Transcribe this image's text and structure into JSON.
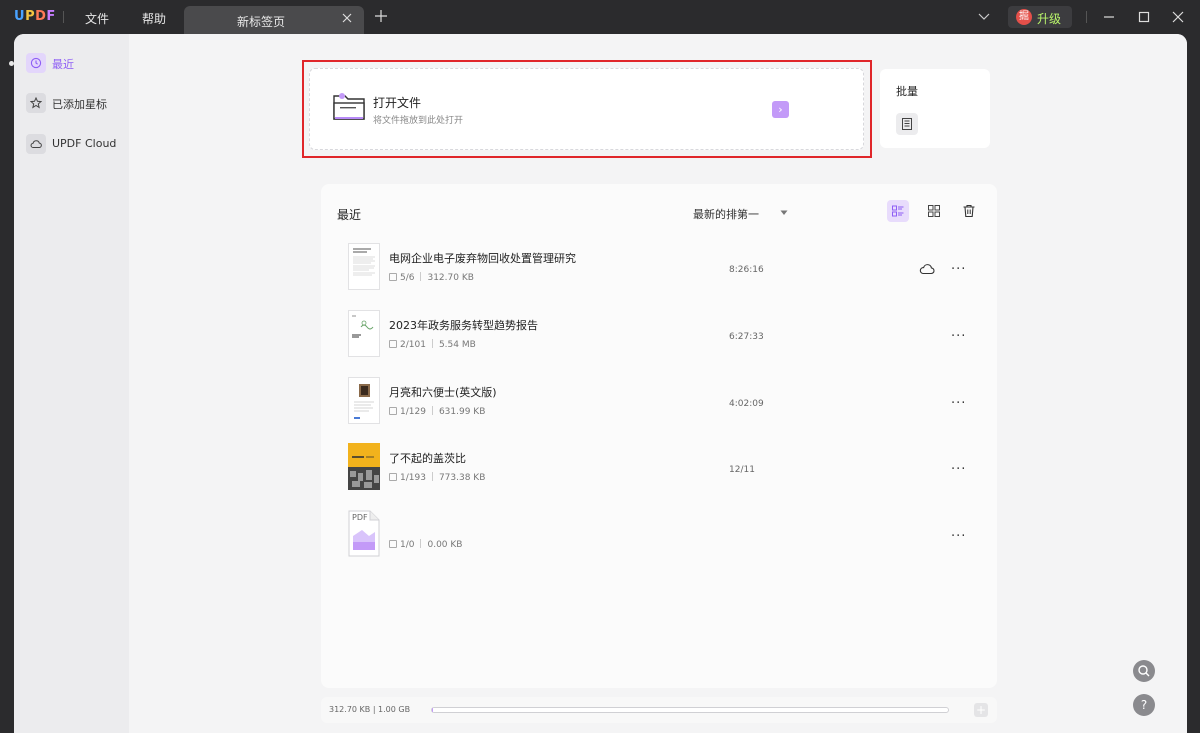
{
  "titlebar": {
    "logo": {
      "u": "U",
      "p": "P",
      "d": "D",
      "f": "F"
    },
    "menu": {
      "file": "文件",
      "help": "帮助"
    },
    "tab_label": "新标签页",
    "upgrade": {
      "avatar_char": "掘",
      "label": "升级"
    }
  },
  "sidebar": {
    "items": [
      {
        "label": "最近",
        "icon": "clock-icon",
        "active": true
      },
      {
        "label": "已添加星标",
        "icon": "star-icon",
        "active": false
      },
      {
        "label": "UPDF Cloud",
        "icon": "cloud-icon",
        "active": false
      }
    ]
  },
  "open_file": {
    "title": "打开文件",
    "subtitle": "将文件拖放到此处打开",
    "arrow": "›"
  },
  "batch": {
    "title": "批量"
  },
  "recent": {
    "title": "最近",
    "sort_label": "最新的排第一",
    "files": [
      {
        "name": "电网企业电子废弃物回收处置管理研究",
        "page": "5/6",
        "size": "312.70 KB",
        "time": "8:26:16",
        "cloud": true
      },
      {
        "name": "2023年政务服务转型趋势报告",
        "page": "2/101",
        "size": "5.54 MB",
        "time": "6:27:33",
        "cloud": false
      },
      {
        "name": "月亮和六便士(英文版)",
        "page": "1/129",
        "size": "631.99 KB",
        "time": "4:02:09",
        "cloud": false
      },
      {
        "name": "了不起的盖茨比",
        "page": "1/193",
        "size": "773.38 KB",
        "time": "12/11",
        "cloud": false
      },
      {
        "name": "",
        "page": "1/0",
        "size": "0.00 KB",
        "time": "",
        "cloud": false
      }
    ],
    "more_label": "···"
  },
  "storage": {
    "text": "312.70 KB | 1.00 GB",
    "used_fraction": 0.0003,
    "add": "+"
  },
  "fabs": {
    "search": "search-icon",
    "help": "?"
  },
  "colors": {
    "accent": "#8e5ef5",
    "highlight": "#e0262a",
    "upgrade_text": "#b9f56b"
  }
}
